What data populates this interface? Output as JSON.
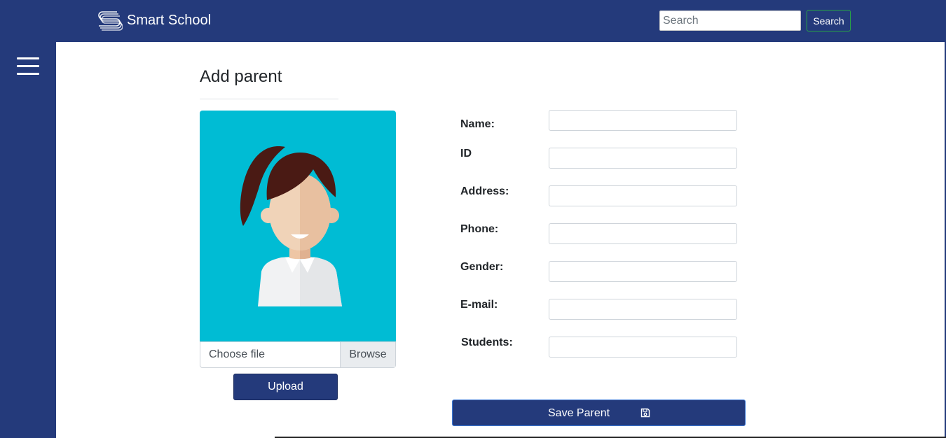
{
  "header": {
    "brand_name": "Smart School",
    "logo_icon": "stacked-s-logo-icon",
    "search": {
      "placeholder": "Search",
      "value": "",
      "button_label": "Search"
    }
  },
  "sidebar": {
    "menu_icon": "hamburger-menu-icon"
  },
  "main": {
    "title": "Add parent",
    "photo": {
      "illustration": "female-avatar-illustration",
      "background": "#00bcd4"
    },
    "file_input": {
      "label": "Choose file",
      "browse_label": "Browse"
    },
    "upload_label": "Upload",
    "form": {
      "fields": [
        {
          "label": "Name:"
        },
        {
          "label": "ID"
        },
        {
          "label": "Address:"
        },
        {
          "label": "Phone:"
        },
        {
          "label": "Gender:"
        },
        {
          "label": "E-mail:"
        },
        {
          "label": "Students:"
        }
      ],
      "save_label": "Save Parent",
      "save_icon": "floppy-disk-icon"
    }
  },
  "colors": {
    "primary": "#243a7b",
    "accent": "#00bcd4",
    "search_border": "#28a745"
  }
}
